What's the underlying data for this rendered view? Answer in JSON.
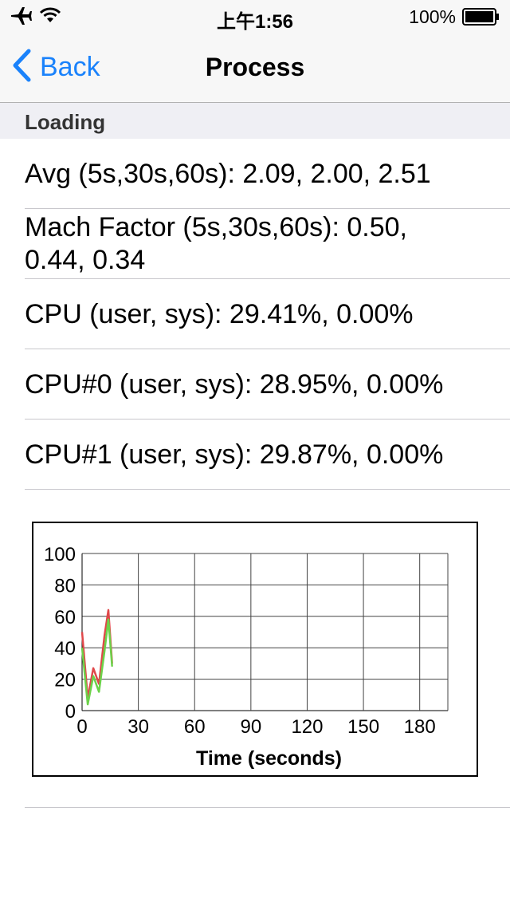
{
  "status_bar": {
    "time": "上午1:56",
    "battery_percent": "100%",
    "icons": [
      "airplane-icon",
      "wifi-icon",
      "battery-icon"
    ]
  },
  "nav": {
    "back_label": "Back",
    "title": "Process",
    "accent_color": "#1a82fb"
  },
  "section": {
    "header": "Loading"
  },
  "rows": [
    {
      "text": "Avg (5s,30s,60s): 2.09, 2.00, 2.51"
    },
    {
      "text_line1": "Mach Factor (5s,30s,60s): 0.50,",
      "text_line2": "0.44, 0.34"
    },
    {
      "text": "CPU (user, sys): 29.41%, 0.00%"
    },
    {
      "text": "CPU#0 (user, sys): 28.95%, 0.00%"
    },
    {
      "text": "CPU#1 (user, sys): 29.87%, 0.00%"
    }
  ],
  "chart_data": {
    "type": "line",
    "title": "",
    "xlabel": "Time (seconds)",
    "ylabel": "",
    "xlim": [
      0,
      195
    ],
    "ylim": [
      0,
      100
    ],
    "x_ticks": [
      0,
      30,
      60,
      90,
      120,
      150,
      180
    ],
    "y_ticks": [
      0,
      20,
      40,
      60,
      80,
      100
    ],
    "grid": true,
    "series": [
      {
        "color": "#e0484a",
        "x": [
          0,
          3,
          6,
          9,
          12,
          14,
          16
        ],
        "y": [
          50,
          8,
          27,
          17,
          48,
          64,
          30
        ]
      },
      {
        "color": "#6cd24a",
        "x": [
          0,
          3,
          6,
          9,
          12,
          14,
          16
        ],
        "y": [
          40,
          4,
          22,
          12,
          38,
          58,
          28
        ]
      }
    ]
  }
}
